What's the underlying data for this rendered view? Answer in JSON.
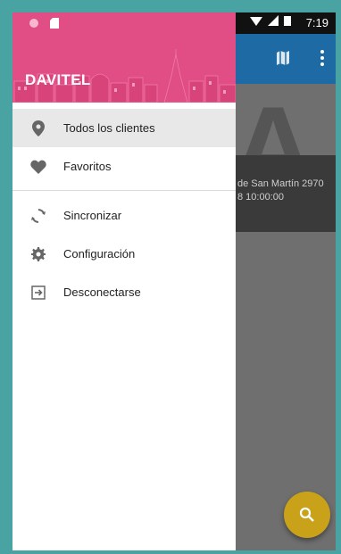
{
  "status_bar": {
    "time": "7:19"
  },
  "app": {
    "card_address": "de San Martín 2970",
    "card_date": "8 10:00:00",
    "big_letter": "A"
  },
  "drawer": {
    "account_name": "DAVITEL",
    "menu": [
      {
        "label": "Todos los clientes",
        "icon": "location-pin-icon",
        "active": true
      },
      {
        "label": "Favoritos",
        "icon": "heart-icon"
      }
    ],
    "menu2": [
      {
        "label": "Sincronizar",
        "icon": "sync-icon"
      },
      {
        "label": "Configuración",
        "icon": "gear-icon"
      },
      {
        "label": "Desconectarse",
        "icon": "logout-icon"
      }
    ]
  },
  "colors": {
    "drawer_header": "#e14d85",
    "app_bar": "#1d6aa5",
    "fab": "#c9a21a"
  }
}
